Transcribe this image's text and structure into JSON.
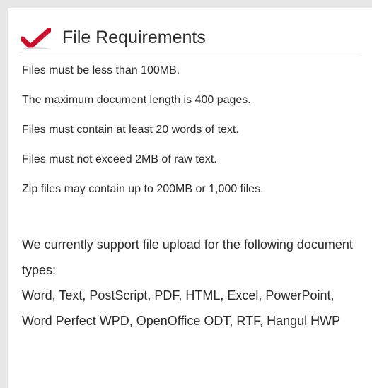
{
  "header": {
    "icon": "checkmark-icon",
    "title": "File Requirements"
  },
  "requirements": [
    "Files must be less than 100MB.",
    "The maximum document length is 400 pages.",
    "Files must contain at least 20 words of text.",
    "Files must not exceed 2MB of raw text.",
    "Zip files may contain up to 200MB or 1,000 files."
  ],
  "support": {
    "intro": "We currently support file upload for the following document types:",
    "types": "Word, Text, PostScript, PDF, HTML, Excel, PowerPoint, Word Perfect WPD, OpenOffice ODT, RTF, Hangul HWP"
  },
  "colors": {
    "check": "#c8102e",
    "background": "#e7e7e7",
    "panel": "#ffffff"
  }
}
